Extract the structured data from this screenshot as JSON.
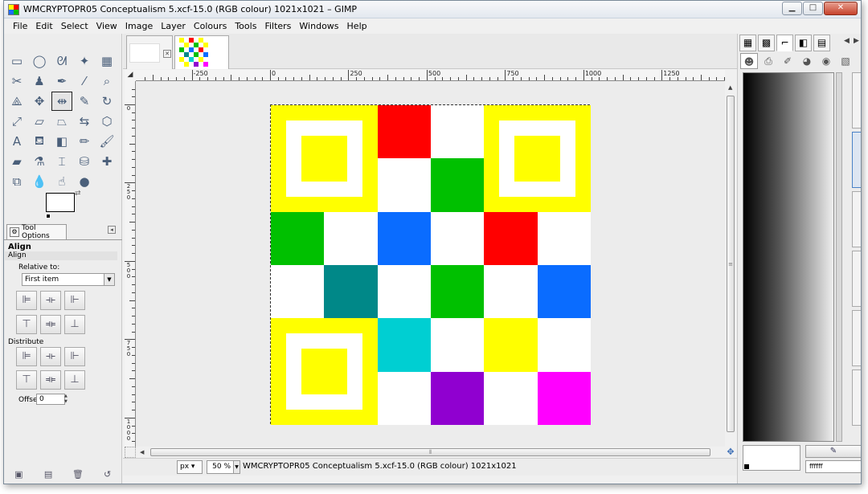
{
  "window": {
    "title": "WMCRYPTOPR05 Conceptualism 5.xcf-15.0 (RGB colour) 1021x1021 – GIMP",
    "minimize": "▁",
    "maximize": "□",
    "close": "✕"
  },
  "menu": [
    "File",
    "Edit",
    "Select",
    "View",
    "Image",
    "Layer",
    "Colours",
    "Tools",
    "Filters",
    "Windows",
    "Help"
  ],
  "toolbox": {
    "tools": [
      {
        "name": "rect-select-icon",
        "glyph": "▭"
      },
      {
        "name": "ellipse-select-icon",
        "glyph": "◯"
      },
      {
        "name": "free-select-icon",
        "glyph": "ᘛ"
      },
      {
        "name": "fuzzy-select-icon",
        "glyph": "✦"
      },
      {
        "name": "color-select-icon",
        "glyph": "▦"
      },
      {
        "name": "scissors-icon",
        "glyph": "✂"
      },
      {
        "name": "foreground-select-icon",
        "glyph": "♟"
      },
      {
        "name": "paths-icon",
        "glyph": "✒"
      },
      {
        "name": "color-picker-icon",
        "glyph": "⁄"
      },
      {
        "name": "zoom-icon",
        "glyph": "⌕"
      },
      {
        "name": "measure-icon",
        "glyph": "⟁"
      },
      {
        "name": "move-icon",
        "glyph": "✥"
      },
      {
        "name": "align-icon",
        "glyph": "⇹"
      },
      {
        "name": "crop-icon",
        "glyph": "✎"
      },
      {
        "name": "rotate-icon",
        "glyph": "↻"
      },
      {
        "name": "scale-icon",
        "glyph": "⤢"
      },
      {
        "name": "shear-icon",
        "glyph": "▱"
      },
      {
        "name": "perspective-icon",
        "glyph": "⏢"
      },
      {
        "name": "flip-icon",
        "glyph": "⇆"
      },
      {
        "name": "cage-icon",
        "glyph": "⬡"
      },
      {
        "name": "text-icon",
        "glyph": "A"
      },
      {
        "name": "bucket-fill-icon",
        "glyph": "⛾"
      },
      {
        "name": "blend-icon",
        "glyph": "◧"
      },
      {
        "name": "pencil-icon",
        "glyph": "✏"
      },
      {
        "name": "paintbrush-icon",
        "glyph": "🖌"
      },
      {
        "name": "eraser-icon",
        "glyph": "▰"
      },
      {
        "name": "airbrush-icon",
        "glyph": "⚗"
      },
      {
        "name": "ink-icon",
        "glyph": "⌶"
      },
      {
        "name": "clone-icon",
        "glyph": "⛁"
      },
      {
        "name": "heal-icon",
        "glyph": "✚"
      },
      {
        "name": "perspective-clone-icon",
        "glyph": "⧉"
      },
      {
        "name": "blur-icon",
        "glyph": "💧"
      },
      {
        "name": "smudge-icon",
        "glyph": "☝"
      },
      {
        "name": "dodge-burn-icon",
        "glyph": "●"
      }
    ],
    "active_tool_index": 12,
    "options_tab": "Tool Options",
    "options_title": "Align",
    "options_sub": "Align",
    "relative_to_label": "Relative to:",
    "relative_to_value": "First item",
    "distribute_label": "Distribute",
    "align_buttons": [
      {
        "name": "align-left-icon",
        "glyph": "⊫"
      },
      {
        "name": "align-hcenter-icon",
        "glyph": "⟛"
      },
      {
        "name": "align-right-icon",
        "glyph": "⊩"
      },
      {
        "name": "align-top-icon",
        "glyph": "⊤"
      },
      {
        "name": "align-vcenter-icon",
        "glyph": "⟚"
      },
      {
        "name": "align-bottom-icon",
        "glyph": "⊥"
      }
    ],
    "distribute_buttons": [
      {
        "name": "distribute-left-icon",
        "glyph": "⊫"
      },
      {
        "name": "distribute-hcenter-icon",
        "glyph": "⟛"
      },
      {
        "name": "distribute-right-icon",
        "glyph": "⊩"
      },
      {
        "name": "distribute-top-icon",
        "glyph": "⊤"
      },
      {
        "name": "distribute-vcenter-icon",
        "glyph": "⟚"
      },
      {
        "name": "distribute-bottom-icon",
        "glyph": "⊥"
      }
    ],
    "offset_label": "Offset:",
    "offset_value": "0",
    "bottom_icons": [
      {
        "name": "save-options-icon",
        "glyph": "▣"
      },
      {
        "name": "restore-options-icon",
        "glyph": "▤"
      },
      {
        "name": "delete-options-icon",
        "glyph": "🗑"
      },
      {
        "name": "reset-options-icon",
        "glyph": "↺"
      }
    ]
  },
  "rulers": {
    "corner": "◢",
    "h_labels": [
      "-250",
      "0",
      "250",
      "500",
      "750",
      "1000",
      "1250"
    ],
    "v_labels": [
      "0",
      "250",
      "500",
      "750",
      "1000"
    ]
  },
  "image": {
    "colors": {
      "yellow": "#ffff00",
      "red": "#ff0000",
      "green": "#00c000",
      "blue": "#0a6cff",
      "teal": "#008888",
      "cyan": "#00cfd2",
      "purple": "#9000d0",
      "magenta": "#ff00ff",
      "white": "#ffffff"
    },
    "grid": [
      [
        "F",
        "F",
        "red",
        "white",
        "F",
        "F"
      ],
      [
        "F",
        "F",
        "white",
        "green",
        "F",
        "F"
      ],
      [
        "green",
        "white",
        "blue",
        "white",
        "red",
        "white"
      ],
      [
        "white",
        "teal",
        "white",
        "green",
        "white",
        "blue"
      ],
      [
        "F",
        "F",
        "cyan",
        "white",
        "yellow",
        "white"
      ],
      [
        "F",
        "F",
        "white",
        "purple",
        "white",
        "magenta"
      ]
    ]
  },
  "statusbar": {
    "unit": "px",
    "zoom": "50 %",
    "text": "WMCRYPTOPR05 Conceptualism 5.xcf-15.0 (RGB colour) 1021x1021"
  },
  "dock": {
    "tabs": [
      {
        "name": "brushes-tab-icon",
        "glyph": "▦"
      },
      {
        "name": "patterns-tab-icon",
        "glyph": "▩"
      },
      {
        "name": "paths-tab-icon",
        "glyph": "⌐"
      },
      {
        "name": "gradients-tab-icon",
        "glyph": "◧"
      },
      {
        "name": "palette-tab-icon",
        "glyph": "▤"
      }
    ],
    "nav_left": "◀",
    "nav_right": "▶",
    "row2": [
      {
        "name": "gimp-mascot-icon",
        "glyph": "☻"
      },
      {
        "name": "printer-icon",
        "glyph": "⎙"
      },
      {
        "name": "brush-tab-icon",
        "glyph": "✐"
      },
      {
        "name": "color-wheel-icon",
        "glyph": "◕"
      },
      {
        "name": "scales-icon",
        "glyph": "◉"
      },
      {
        "name": "watercolor-icon",
        "glyph": "▧"
      }
    ],
    "edit_button": "✎",
    "hex_value": "ffffff"
  }
}
